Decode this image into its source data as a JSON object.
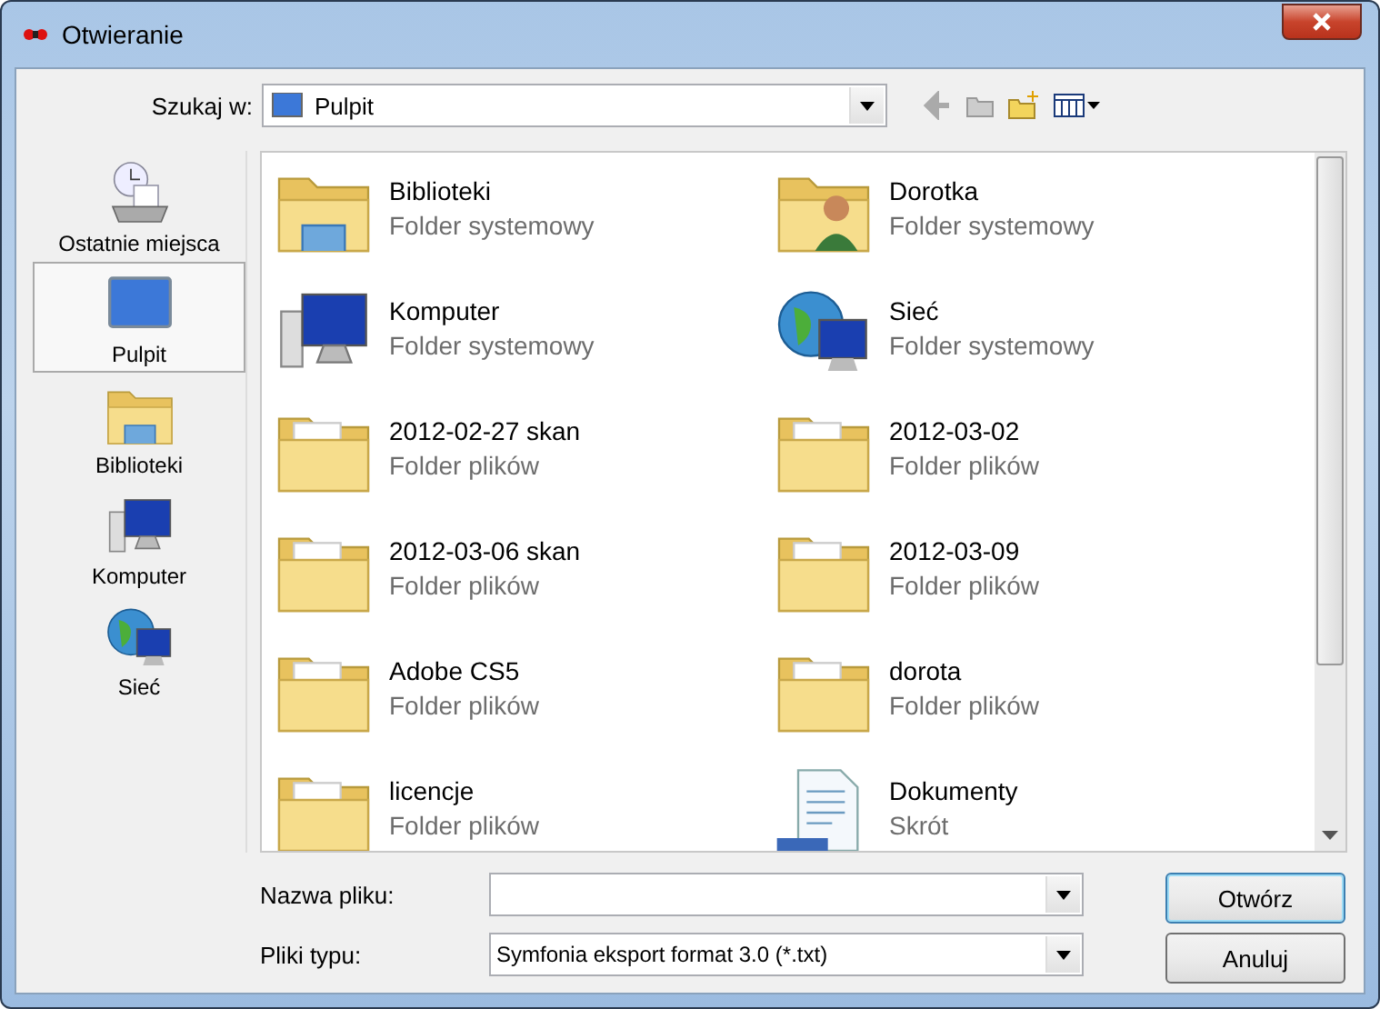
{
  "window": {
    "title": "Otwieranie"
  },
  "toolbar": {
    "label": "Szukaj w:",
    "location": "Pulpit"
  },
  "sidebar": {
    "items": [
      {
        "label": "Ostatnie miejsca",
        "kind": "recent",
        "selected": false
      },
      {
        "label": "Pulpit",
        "kind": "desktop",
        "selected": true
      },
      {
        "label": "Biblioteki",
        "kind": "library",
        "selected": false
      },
      {
        "label": "Komputer",
        "kind": "computer",
        "selected": false
      },
      {
        "label": "Sieć",
        "kind": "network",
        "selected": false
      }
    ]
  },
  "files": [
    {
      "name": "Biblioteki",
      "type": "Folder systemowy",
      "kind": "library"
    },
    {
      "name": "Dorotka",
      "type": "Folder systemowy",
      "kind": "user"
    },
    {
      "name": "Komputer",
      "type": "Folder systemowy",
      "kind": "computer"
    },
    {
      "name": "Sieć",
      "type": "Folder systemowy",
      "kind": "network"
    },
    {
      "name": "2012-02-27 skan",
      "type": "Folder plików",
      "kind": "folder"
    },
    {
      "name": "2012-03-02",
      "type": "Folder plików",
      "kind": "folder"
    },
    {
      "name": "2012-03-06 skan",
      "type": "Folder plików",
      "kind": "folder"
    },
    {
      "name": "2012-03-09",
      "type": "Folder plików",
      "kind": "folder"
    },
    {
      "name": "Adobe CS5",
      "type": "Folder plików",
      "kind": "folder"
    },
    {
      "name": "dorota",
      "type": "Folder plików",
      "kind": "folder"
    },
    {
      "name": "licencje",
      "type": "Folder plików",
      "kind": "folder"
    },
    {
      "name": "Dokumenty",
      "type": "Skrót",
      "kind": "shortcut"
    }
  ],
  "filename": {
    "label": "Nazwa pliku:"
  },
  "filetype": {
    "label": "Pliki typu:",
    "value": "Symfonia eksport format 3.0 (*.txt)"
  },
  "buttons": [
    "Otwórz",
    "Anuluj"
  ]
}
